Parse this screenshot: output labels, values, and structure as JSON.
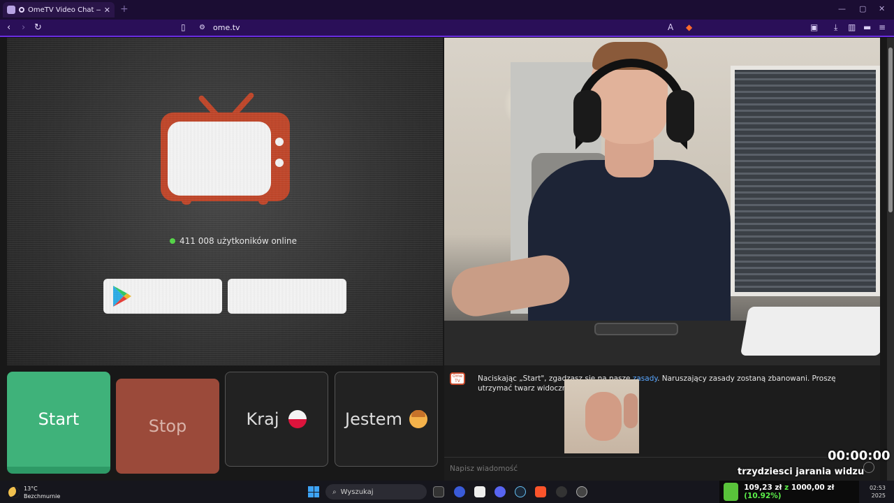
{
  "browser": {
    "tab_title": "OmeTV Video Chat — Omeg",
    "tab_close": "✕",
    "new_tab": "+",
    "url": "ome.tv"
  },
  "status": {
    "online_text": "411 008 użytkoników online"
  },
  "controls": {
    "start": "Start",
    "stop": "Stop",
    "country": "Kraj",
    "gender": "Jestem"
  },
  "chat": {
    "logo_text": "Ome TV",
    "message_before": "Naciskając „Start\", zgadzasz się na nasze ",
    "message_link": "zasady",
    "message_after": ". Naruszający zasady zostaną zbanowani. Proszę utrzymać twarz widoczną w kadrze kamery.",
    "input_placeholder": "Napisz wiadomość"
  },
  "overlay": {
    "timer": "00:00:00",
    "caption": "trzydziesci jarania widzu"
  },
  "taskbar": {
    "temperature": "13°C",
    "weather": "Bezchmurnie",
    "search_label": "Wyszukaj",
    "stock_value": "109,23 zł",
    "stock_mid": " z ",
    "stock_target": "1000,00 zł",
    "stock_pct": " (10.92%)",
    "time": "02:53",
    "date": "2025"
  },
  "colors": {
    "accent_purple": "#6a2ee0",
    "start_green": "#3fb27a",
    "stop_red": "#9b4a3a",
    "tv_red": "#c94a2c",
    "online_green": "#58e04a"
  }
}
